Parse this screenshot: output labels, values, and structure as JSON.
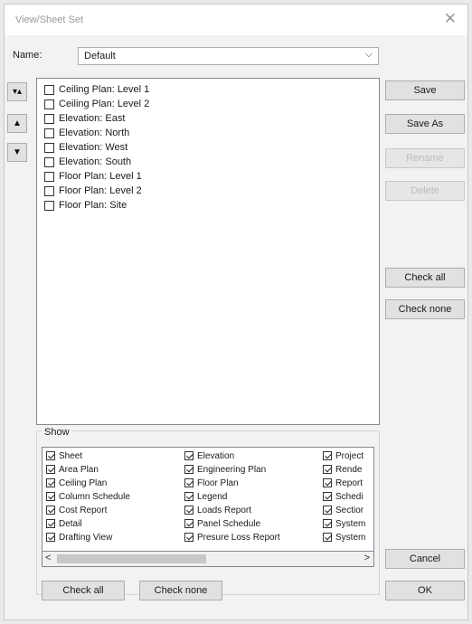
{
  "window": {
    "title": "View/Sheet Set",
    "close_glyph": "✕"
  },
  "name_field": {
    "label": "Name:",
    "value": "Default",
    "chevron": "⌵"
  },
  "order_buttons": {
    "sort": "▾▴",
    "up": "▲",
    "down": "▼"
  },
  "sheets": [
    {
      "label": "Ceiling Plan: Level 1",
      "checked": false
    },
    {
      "label": "Ceiling Plan: Level 2",
      "checked": false
    },
    {
      "label": "Elevation: East",
      "checked": false
    },
    {
      "label": "Elevation: North",
      "checked": false
    },
    {
      "label": "Elevation: West",
      "checked": false
    },
    {
      "label": "Elevation: South",
      "checked": false
    },
    {
      "label": "Floor Plan: Level 1",
      "checked": false
    },
    {
      "label": "Floor Plan: Level 2",
      "checked": false
    },
    {
      "label": "Floor Plan: Site",
      "checked": false
    }
  ],
  "buttons": {
    "save": "Save",
    "save_as": "Save As",
    "rename": "Rename",
    "delete": "Delete",
    "check_all": "Check all",
    "check_none": "Check none",
    "cancel": "Cancel",
    "ok": "OK"
  },
  "show": {
    "label": "Show",
    "columns": [
      [
        "Sheet",
        "Area Plan",
        "Ceiling Plan",
        "Column Schedule",
        "Cost Report",
        "Detail",
        "Drafting View"
      ],
      [
        "Elevation",
        "Engineering Plan",
        "Floor Plan",
        "Legend",
        "Loads Report",
        "Panel Schedule",
        "Presure Loss Report"
      ],
      [
        "Project",
        "Rende",
        "Report",
        "Schedi",
        "Sectior",
        "System",
        "System"
      ]
    ],
    "check_all": "Check all",
    "check_none": "Check none",
    "scroll_left": "<",
    "scroll_right": ">"
  }
}
